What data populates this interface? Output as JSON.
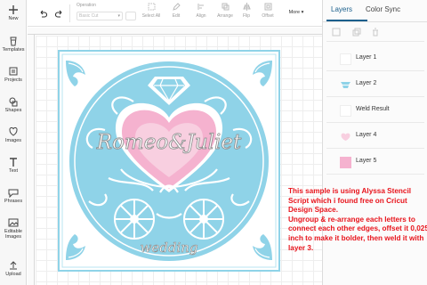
{
  "left_toolbar": {
    "items": [
      {
        "label": "New",
        "icon": "plus-icon"
      },
      {
        "label": "Templates",
        "icon": "templates-icon"
      },
      {
        "label": "Projects",
        "icon": "projects-icon"
      },
      {
        "label": "Shapes",
        "icon": "shapes-icon"
      },
      {
        "label": "Images",
        "icon": "images-icon"
      },
      {
        "label": "Text",
        "icon": "text-icon"
      },
      {
        "label": "Phrases",
        "icon": "phrases-icon"
      },
      {
        "label": "Editable Images",
        "icon": "editable-images-icon"
      },
      {
        "label": "Upload",
        "icon": "upload-icon"
      }
    ]
  },
  "top_toolbar": {
    "operation_label": "Operation",
    "operation_value": "Basic Cut",
    "select_all_label": "Select All",
    "edit_label": "Edit",
    "align_label": "Align",
    "arrange_label": "Arrange",
    "flip_label": "Flip",
    "offset_label": "Offset",
    "more_label": "More"
  },
  "right_panel": {
    "tabs": [
      "Layers",
      "Color Sync"
    ],
    "layers": [
      {
        "name": "Layer 1",
        "thumb": "white"
      },
      {
        "name": "Layer 2",
        "thumb": "blue"
      },
      {
        "name": "Weld Result",
        "thumb": "white"
      },
      {
        "name": "Layer 4",
        "thumb": "pink-light"
      },
      {
        "name": "Layer 5",
        "thumb": "pink"
      }
    ]
  },
  "design": {
    "title_text": "Romeo&Juliet",
    "subtitle_text": "wedding"
  },
  "annotation": {
    "text": "This sample is using Alyssa Stencil Script which i found free on Cricut Design Space.\nUngroup & re-arrange each letters to connect each other edges, offset it 0,025 inch to make it bolder, then weld it with layer 3."
  },
  "colors": {
    "accent": "#1a5f8c",
    "design_blue": "#8fd3e8",
    "design_pink": "#f5b2cf",
    "design_pink_light": "#f8cfe0",
    "annotation": "#e8141c"
  }
}
